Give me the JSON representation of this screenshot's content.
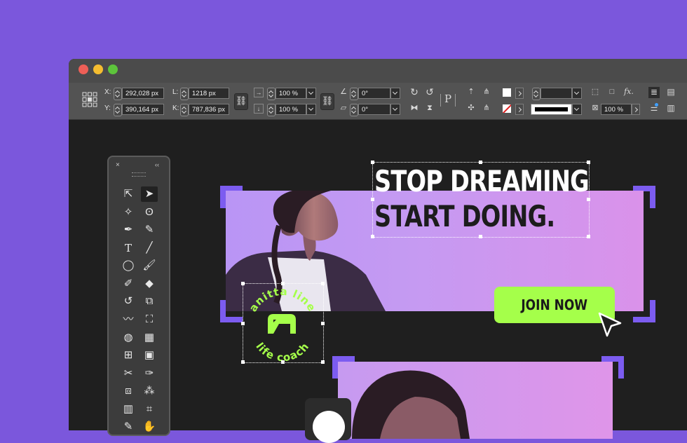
{
  "toolbar": {
    "x_label": "X:",
    "y_label": "Y:",
    "x_value": "292,028 px",
    "y_value": "390,164 px",
    "l_label": "L:",
    "k_label": "K:",
    "l_value": "1218 px",
    "k_value": "787,836 px",
    "scale_x": "100 %",
    "scale_y": "100 %",
    "rotate": "0°",
    "shear": "0°",
    "opacity": "100 %",
    "fx_label": "fx."
  },
  "tools_panel": {
    "close": "×",
    "collapse": "‹‹"
  },
  "design": {
    "headline_line1": "STOP DREAMING",
    "headline_line2": "START DOING.",
    "cta_label": "JOIN NOW",
    "logo_top_text": "anitta line",
    "logo_bottom_text": "life coach",
    "logo_letter": "A"
  },
  "colors": {
    "background": "#7b57dc",
    "accent_green": "#a5ff4a",
    "bracket_purple": "#7c5cf0"
  }
}
